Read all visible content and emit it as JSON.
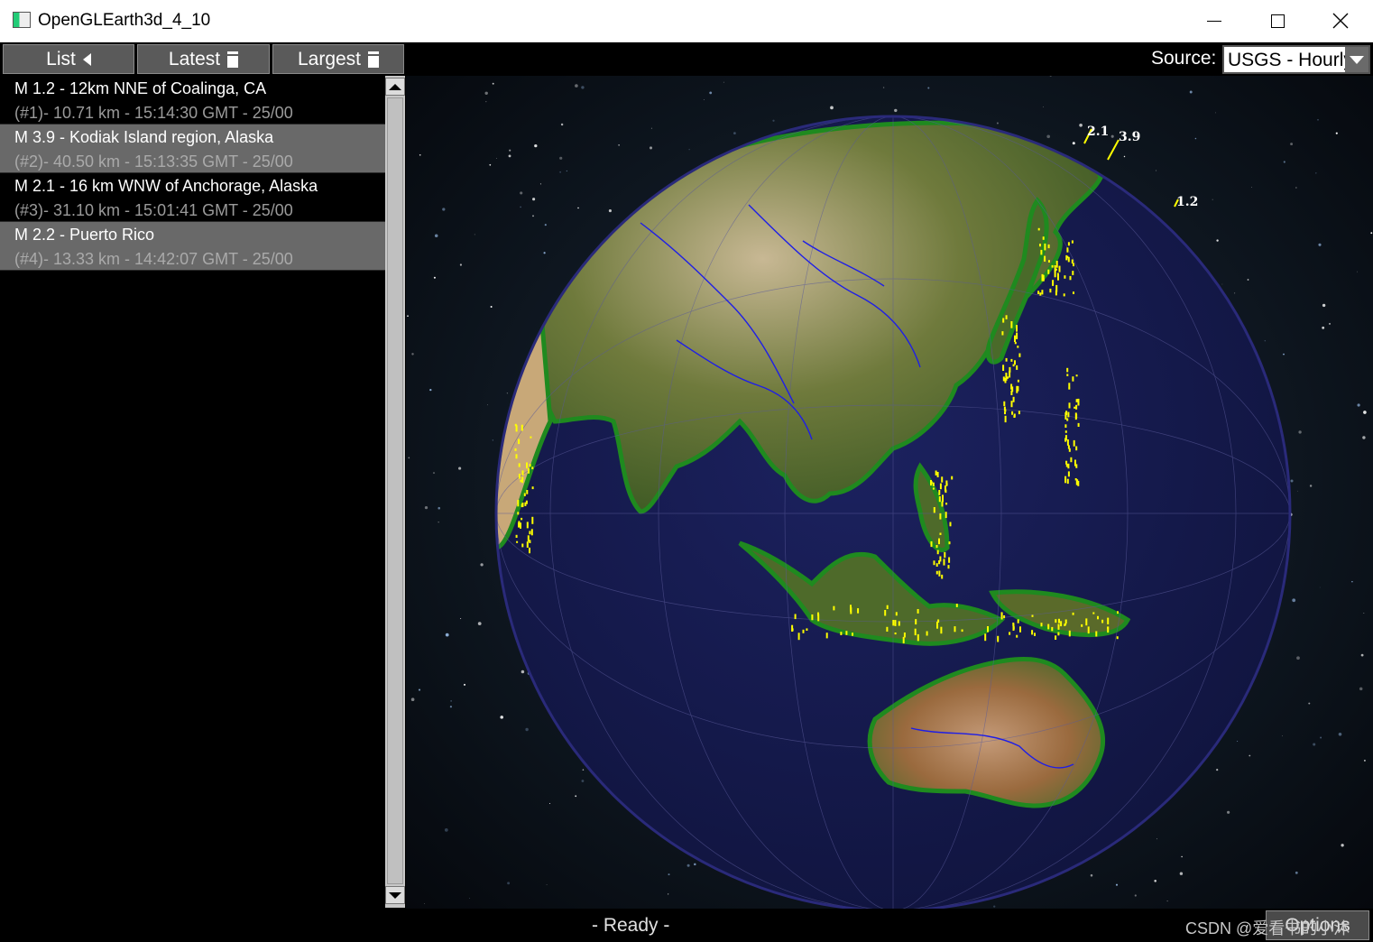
{
  "window": {
    "title": "OpenGLEarth3d_4_10",
    "controls": [
      "minimize",
      "maximize",
      "close"
    ]
  },
  "toolbar": {
    "list_label": "List",
    "latest_label": "Latest",
    "largest_label": "Largest"
  },
  "source": {
    "label": "Source:",
    "selected": "USGS - Hourly"
  },
  "quakes": [
    {
      "title": "M 1.2 - 12km NNE of Coalinga, CA",
      "detail": "(#1)- 10.71 km - 15:14:30 GMT - 25/00"
    },
    {
      "title": "M 3.9 - Kodiak Island region, Alaska",
      "detail": "(#2)- 40.50 km - 15:13:35 GMT - 25/00"
    },
    {
      "title": "M 2.1 - 16 km WNW of Anchorage, Alaska",
      "detail": "(#3)- 31.10 km - 15:01:41 GMT - 25/00"
    },
    {
      "title": "M 2.2 - Puerto Rico",
      "detail": "(#4)- 13.33 km - 14:42:07 GMT - 25/00"
    }
  ],
  "globe_labels": {
    "m1": "2.1",
    "m2": "3.9",
    "m3": "1.2"
  },
  "status": {
    "text": "- Ready -",
    "options_label": "Options"
  },
  "watermark": "CSDN @爱看书的小沐",
  "colors": {
    "ocean": "#161a4e",
    "coastline": "#1f8a1f",
    "rivers": "#1e1ee6",
    "quake_markers": "#ffff00"
  }
}
